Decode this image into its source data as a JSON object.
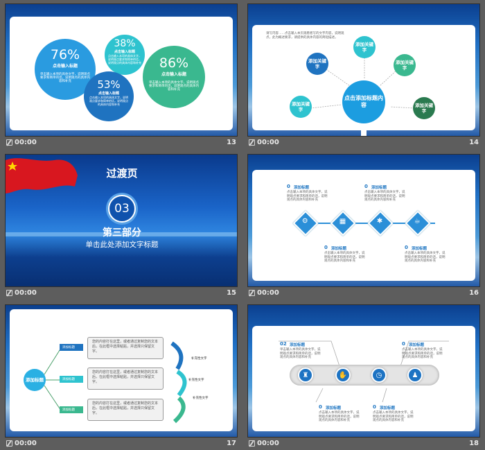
{
  "slides": [
    {
      "number": "13",
      "time": "00:00",
      "bubbles": [
        {
          "pct": "76%",
          "title": "点击输入标题",
          "text": "单击输入本项的具体文字，说明观点要求和简单的话，说明观点的具体内容和补充",
          "color": "#2a9be0"
        },
        {
          "pct": "38%",
          "title": "点击输入标题",
          "text": "点击输入本项的具体文字，说明观点要求和简单的话，说明观点的具体内容和补充",
          "color": "#2ec3cf"
        },
        {
          "pct": "53%",
          "title": "点击输入标题",
          "text": "点击输入本项的具体文字，说明观点要求和简单的话，说明观点的具体内容和补充",
          "color": "#1f73c0"
        },
        {
          "pct": "86%",
          "title": "点击输入标题",
          "text": "单击输入本项的具体文字，说明观点要求和简单的话，说明观点的具体内容和补充",
          "color": "#3ab88f"
        }
      ]
    },
    {
      "number": "14",
      "time": "00:00",
      "intro": "请写内容……点击输入本页观看者写的文字内容，说明观点，此为概述要求，请提供的具体内容的简短描述。",
      "center": "点击添加标题内容",
      "keywords": [
        "添加关键字",
        "添加关键字",
        "添加关键字",
        "添加关键字",
        "添加关键字"
      ]
    },
    {
      "number": "15",
      "time": "00:00",
      "title": "过渡页",
      "index": "03",
      "part": "第三部分",
      "subtitle": "单击此处添加文字标题"
    },
    {
      "number": "16",
      "time": "00:00",
      "items": [
        {
          "n": "0",
          "label": "添加标题",
          "text": "点击输入本项的具体文字，说明观点要求和简单的话，说明观点的具体内容和补充"
        },
        {
          "n": "0",
          "label": "添加标题",
          "text": "点击输入本项的具体文字，说明观点要求和简单的话，说明观点的具体内容和补充"
        },
        {
          "n": "0",
          "label": "添加标题",
          "text": "点击输入本项的具体文字，说明观点要求和简单的话，说明观点的具体内容和补充"
        },
        {
          "n": "0",
          "label": "添加标题",
          "text": "点击输入本项的具体文字，说明观点要求和简单的话，说明观点的具体内容和补充"
        }
      ]
    },
    {
      "number": "17",
      "time": "00:00",
      "root": "添加标题",
      "tags": [
        "添加标题",
        "添加标题",
        "添加标题"
      ],
      "boxes": [
        "您的内容打在这里，或者通过复制您的文本后，在此框中选择粘贴，并选择只保留文字。",
        "您的内容打在这里，或者通过复制您的文本后，在此框中选择粘贴，并选择只保留文字。",
        "您的内容打在这里，或者通过复制您的文本后，在此框中选择粘贴，并选择只保留文字。"
      ],
      "notes": [
        "补充性文字",
        "补充性文字",
        "补充性文字"
      ]
    },
    {
      "number": "18",
      "time": "00:00",
      "items": [
        {
          "n": "02",
          "label": "添加标题",
          "text": "单击输入本项的具体文字，说明观点要求和简单的话，说明观点的具体内容和补充"
        },
        {
          "n": "0",
          "label": "添加标题",
          "text": "点击输入本项的具体文字，说明观点要求和简单的话，说明观点的具体内容和补充"
        },
        {
          "n": "0",
          "label": "添加标题",
          "text": "点击输入本项的具体文字，说明观点要求和简单的话，说明观点的具体内容和补充"
        },
        {
          "n": "0",
          "label": "添加标题",
          "text": "点击输入本项的具体文字，说明观点要求和简单的话，说明观点的具体内容和补充"
        }
      ]
    }
  ]
}
